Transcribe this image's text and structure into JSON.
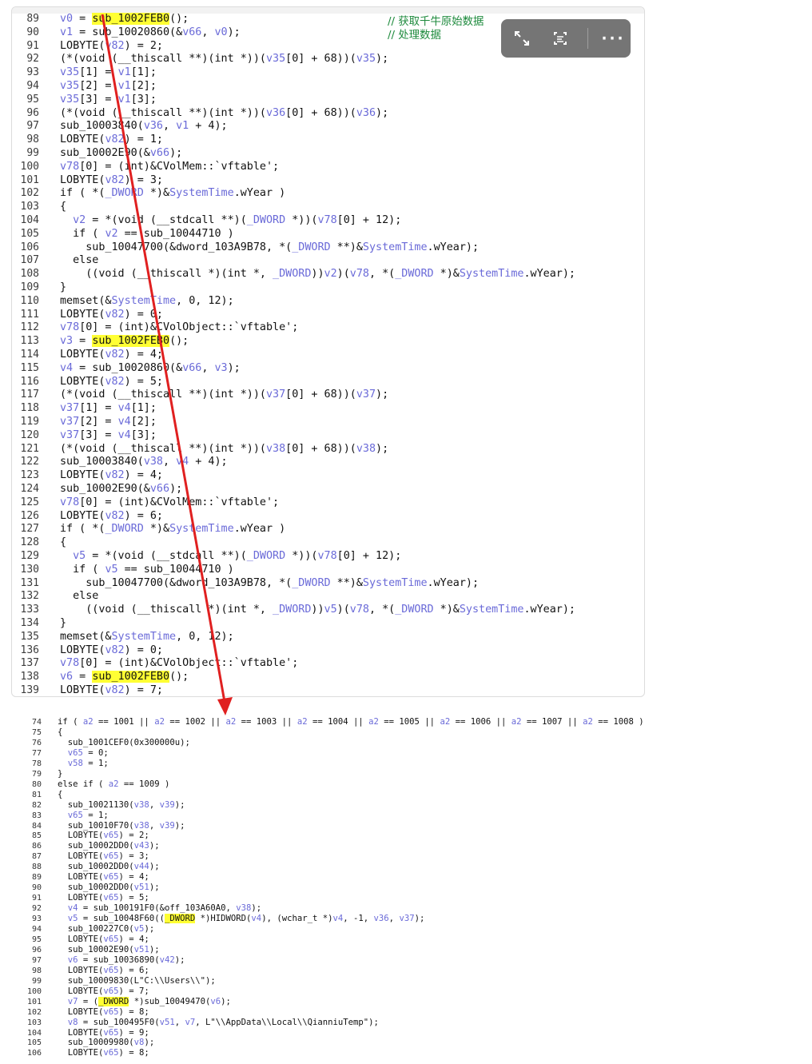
{
  "top": {
    "comment1": "// 获取千牛原始数据",
    "comment2": "// 处理数据",
    "lines": [
      {
        "n": "89",
        "t": "v0 = [[sub_1002FEB0]]();"
      },
      {
        "n": "90",
        "t": "v1 = sub_10020860(&v66, v0);"
      },
      {
        "n": "91",
        "t": "LOBYTE(v82) = 2;"
      },
      {
        "n": "92",
        "t": "(*(void (__thiscall **)(int *))(v35[0] + 68))(v35);"
      },
      {
        "n": "93",
        "t": "v35[1] = v1[1];"
      },
      {
        "n": "94",
        "t": "v35[2] = v1[2];"
      },
      {
        "n": "95",
        "t": "v35[3] = v1[3];"
      },
      {
        "n": "96",
        "t": "(*(void (__thiscall **)(int *))(v36[0] + 68))(v36);"
      },
      {
        "n": "97",
        "t": "sub_10003840(v36, v1 + 4);"
      },
      {
        "n": "98",
        "t": "LOBYTE(v82) = 1;"
      },
      {
        "n": "99",
        "t": "sub_10002E90(&v66);"
      },
      {
        "n": "100",
        "t": "v78[0] = (int)&CVolMem::`vftable';"
      },
      {
        "n": "101",
        "t": "LOBYTE(v82) = 3;"
      },
      {
        "n": "102",
        "t": "if ( *(_DWORD *)&SystemTime.wYear )"
      },
      {
        "n": "103",
        "t": "{"
      },
      {
        "n": "104",
        "t": "  v2 = *(void (__stdcall **)(_DWORD *))(v78[0] + 12);"
      },
      {
        "n": "105",
        "t": "  if ( v2 == sub_10044710 )"
      },
      {
        "n": "106",
        "t": "    sub_10047700(&dword_103A9B78, *(_DWORD **)&SystemTime.wYear);"
      },
      {
        "n": "107",
        "t": "  else"
      },
      {
        "n": "108",
        "t": "    ((void (__thiscall *)(int *, _DWORD))v2)(v78, *(_DWORD *)&SystemTime.wYear);"
      },
      {
        "n": "109",
        "t": "}"
      },
      {
        "n": "110",
        "t": "memset(&SystemTime, 0, 12);"
      },
      {
        "n": "111",
        "t": "LOBYTE(v82) = 0;"
      },
      {
        "n": "112",
        "t": "v78[0] = (int)&CVolObject::`vftable';"
      },
      {
        "n": "113",
        "t": "v3 = [[sub_1002FEB0]]();"
      },
      {
        "n": "114",
        "t": "LOBYTE(v82) = 4;"
      },
      {
        "n": "115",
        "t": "v4 = sub_10020860(&v66, v3);"
      },
      {
        "n": "116",
        "t": "LOBYTE(v82) = 5;"
      },
      {
        "n": "117",
        "t": "(*(void (__thiscall **)(int *))(v37[0] + 68))(v37);"
      },
      {
        "n": "118",
        "t": "v37[1] = v4[1];"
      },
      {
        "n": "119",
        "t": "v37[2] = v4[2];"
      },
      {
        "n": "120",
        "t": "v37[3] = v4[3];"
      },
      {
        "n": "121",
        "t": "(*(void (__thiscall **)(int *))(v38[0] + 68))(v38);"
      },
      {
        "n": "122",
        "t": "sub_10003840(v38, v4 + 4);"
      },
      {
        "n": "123",
        "t": "LOBYTE(v82) = 4;"
      },
      {
        "n": "124",
        "t": "sub_10002E90(&v66);"
      },
      {
        "n": "125",
        "t": "v78[0] = (int)&CVolMem::`vftable';"
      },
      {
        "n": "126",
        "t": "LOBYTE(v82) = 6;"
      },
      {
        "n": "127",
        "t": "if ( *(_DWORD *)&SystemTime.wYear )"
      },
      {
        "n": "128",
        "t": "{"
      },
      {
        "n": "129",
        "t": "  v5 = *(void (__stdcall **)(_DWORD *))(v78[0] + 12);"
      },
      {
        "n": "130",
        "t": "  if ( v5 == sub_10044710 )"
      },
      {
        "n": "131",
        "t": "    sub_10047700(&dword_103A9B78, *(_DWORD **)&SystemTime.wYear);"
      },
      {
        "n": "132",
        "t": "  else"
      },
      {
        "n": "133",
        "t": "    ((void (__thiscall *)(int *, _DWORD))v5)(v78, *(_DWORD *)&SystemTime.wYear);"
      },
      {
        "n": "134",
        "t": "}"
      },
      {
        "n": "135",
        "t": "memset(&SystemTime, 0, 12);"
      },
      {
        "n": "136",
        "t": "LOBYTE(v82) = 0;"
      },
      {
        "n": "137",
        "t": "v78[0] = (int)&CVolObject::`vftable';"
      },
      {
        "n": "138",
        "t": "v6 = [[sub_1002FEB0]]();"
      },
      {
        "n": "139",
        "t": "LOBYTE(v82) = 7;"
      }
    ]
  },
  "bottom": {
    "lines": [
      {
        "n": "74",
        "t": "if ( a2 == 1001 || a2 == 1002 || a2 == 1003 || a2 == 1004 || a2 == 1005 || a2 == 1006 || a2 == 1007 || a2 == 1008 )"
      },
      {
        "n": "75",
        "t": "{"
      },
      {
        "n": "76",
        "t": "  sub_1001CEF0(0x300000u);"
      },
      {
        "n": "77",
        "t": "  v65 = 0;"
      },
      {
        "n": "78",
        "t": "  v58 = 1;"
      },
      {
        "n": "79",
        "t": "}"
      },
      {
        "n": "80",
        "t": "else if ( a2 == 1009 )"
      },
      {
        "n": "81",
        "t": "{"
      },
      {
        "n": "82",
        "t": "  sub_10021130(v38, v39);"
      },
      {
        "n": "83",
        "t": "  v65 = 1;"
      },
      {
        "n": "84",
        "t": "  sub_10010F70(v38, v39);"
      },
      {
        "n": "85",
        "t": "  LOBYTE(v65) = 2;"
      },
      {
        "n": "86",
        "t": "  sub_10002DD0(v43);"
      },
      {
        "n": "87",
        "t": "  LOBYTE(v65) = 3;"
      },
      {
        "n": "88",
        "t": "  sub_10002DD0(v44);"
      },
      {
        "n": "89",
        "t": "  LOBYTE(v65) = 4;"
      },
      {
        "n": "90",
        "t": "  sub_10002DD0(v51);"
      },
      {
        "n": "91",
        "t": "  LOBYTE(v65) = 5;"
      },
      {
        "n": "92",
        "t": "  v4 = sub_100191F0(&off_103A60A0, v38);"
      },
      {
        "n": "93",
        "t": "  v5 = sub_10048F60(([[_DWORD]] *)HIDWORD(v4), (wchar_t *)v4, -1, v36, v37);"
      },
      {
        "n": "94",
        "t": "  sub_100227C0(v5);"
      },
      {
        "n": "95",
        "t": "  LOBYTE(v65) = 4;"
      },
      {
        "n": "96",
        "t": "  sub_10002E90(v51);"
      },
      {
        "n": "97",
        "t": "  v6 = sub_10036890(v42);"
      },
      {
        "n": "98",
        "t": "  LOBYTE(v65) = 6;"
      },
      {
        "n": "99",
        "t": "  sub_10009830(L\"C:\\\\Users\\\\\");"
      },
      {
        "n": "100",
        "t": "  LOBYTE(v65) = 7;"
      },
      {
        "n": "101",
        "t": "  v7 = ([[_DWORD]] *)sub_10049470(v6);"
      },
      {
        "n": "102",
        "t": "  LOBYTE(v65) = 8;"
      },
      {
        "n": "103",
        "t": "  v8 = sub_100495F0(v51, v7, L\"\\\\AppData\\\\Local\\\\QianniuTemp\");"
      },
      {
        "n": "104",
        "t": "  LOBYTE(v65) = 9;"
      },
      {
        "n": "105",
        "t": "  sub_10009980(v8);"
      },
      {
        "n": "106",
        "t": "  LOBYTE(v65) = 8;"
      }
    ]
  },
  "toolbar": {
    "expand_icon": "expand-icon",
    "ocr_icon": "text-scan-icon",
    "more_icon": "more-icon",
    "more_label": "···"
  },
  "colors": {
    "highlight": "#ffff33",
    "arrow": "#e02020",
    "comment": "#1d8a3c",
    "variable": "#6a6ad8"
  }
}
